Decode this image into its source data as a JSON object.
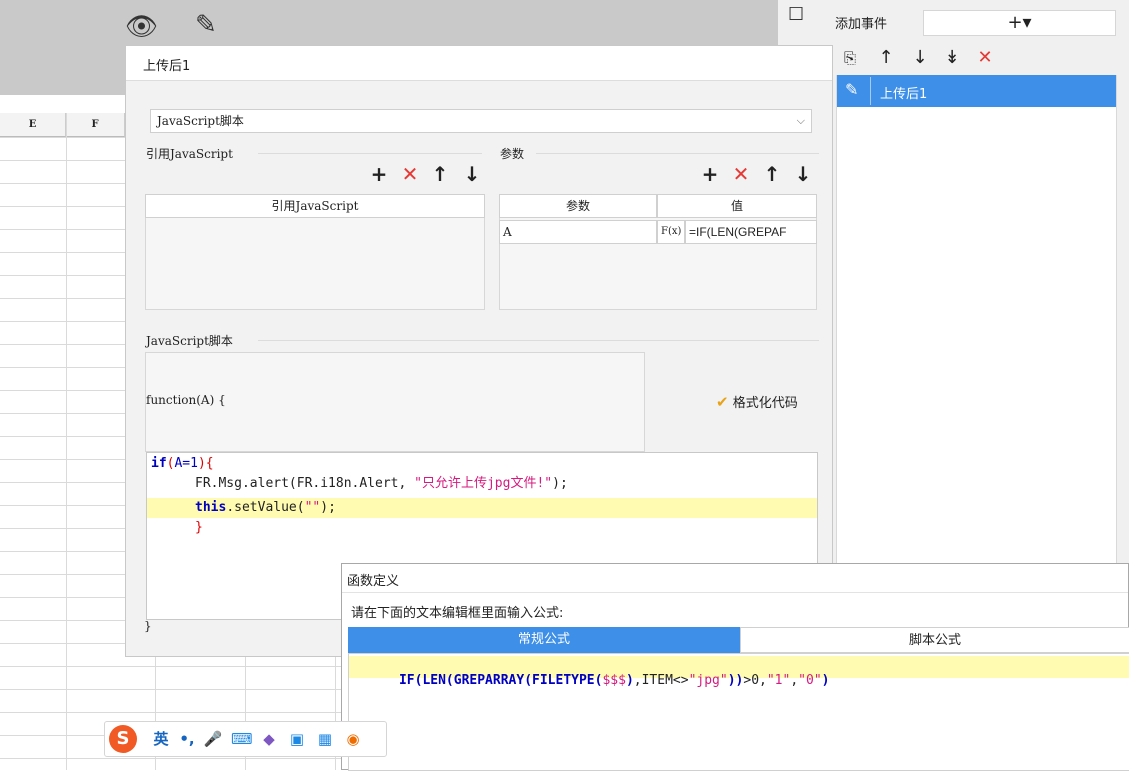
{
  "background": {
    "columns": [
      "E",
      "F"
    ]
  },
  "right_panel": {
    "add_event_label": "添加事件",
    "add_button_label": "+▾",
    "event_item_label": "上传后1"
  },
  "dialog": {
    "title": "上传后1",
    "type_select_value": "JavaScript脚本",
    "ref_section_label": "引用JavaScript",
    "ref_table_header": "引用JavaScript",
    "param_section_label": "参数",
    "param_headers": [
      "参数",
      "值"
    ],
    "param_rows": [
      {
        "name": "A",
        "formula_icon": "F(x)",
        "value": "=IF(LEN(GREPAF"
      }
    ],
    "script_section_label": "JavaScript脚本",
    "function_signature": "function(A) {",
    "format_code_label": "格式化代码",
    "closing_brace": "}",
    "code_lines": [
      "if(A=1){",
      "FR.Msg.alert(FR.i18n.Alert, \"只允许上传jpg文件!\");",
      "this.setValue(\"\");",
      "}"
    ]
  },
  "function_dialog": {
    "title": "函数定义",
    "prompt": "请在下面的文本编辑框里面输入公式:",
    "tabs": [
      "常规公式",
      "脚本公式"
    ],
    "formula": "IF(LEN(GREPARRAY(FILETYPE($$$),ITEM<>\"jpg\"))>0,\"1\",\"0\")"
  },
  "ime_toolbar": {
    "logo": "S",
    "mode_label": "英",
    "punct": "•,"
  },
  "colors": {
    "accent": "#3e8fe8",
    "delete_red": "#e53935",
    "highlight_line": "#fffbb0",
    "keyword": "#0000c0",
    "string": "#d61a7f"
  }
}
